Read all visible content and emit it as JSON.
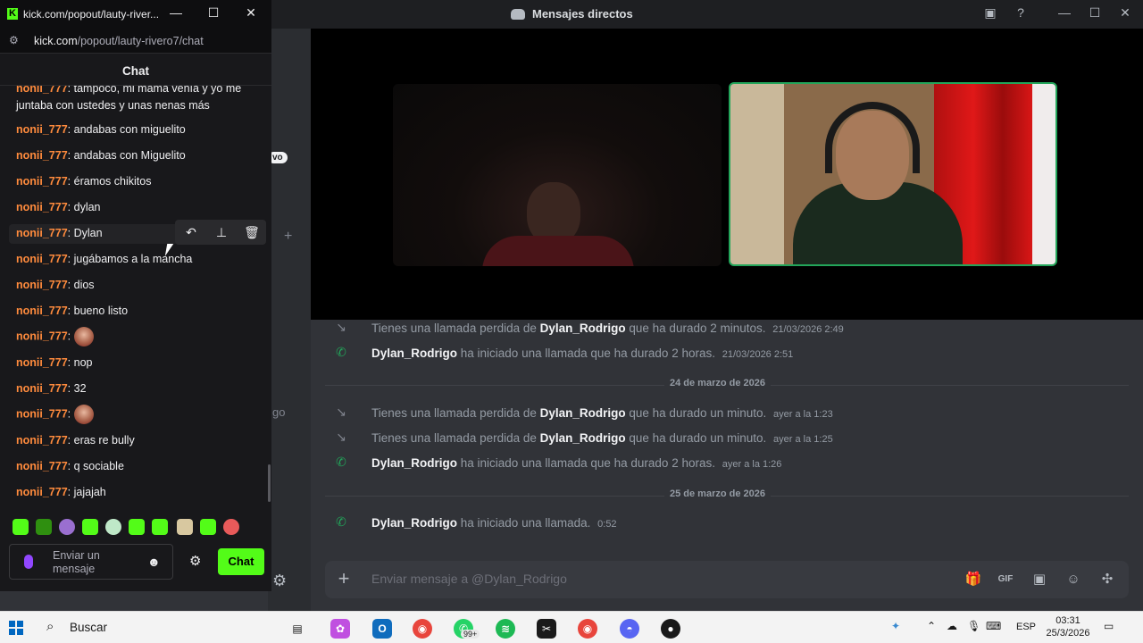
{
  "discord": {
    "window_title": "Mensajes directos",
    "messages": [
      {
        "type": "missed",
        "prefix": "Tienes una llamada perdida de ",
        "user": "Dylan_Rodrigo",
        "suffix": " que ha durado 2 minutos.",
        "time": "21/03/2026 2:49"
      },
      {
        "type": "call",
        "prefix": "",
        "user": "Dylan_Rodrigo",
        "suffix": " ha iniciado una llamada que ha durado 2 horas.",
        "time": "21/03/2026 2:51"
      },
      {
        "type": "missed",
        "prefix": "Tienes una llamada perdida de ",
        "user": "Dylan_Rodrigo",
        "suffix": " que ha durado un minuto.",
        "time": "ayer a la 1:23"
      },
      {
        "type": "missed",
        "prefix": "Tienes una llamada perdida de ",
        "user": "Dylan_Rodrigo",
        "suffix": " que ha durado un minuto.",
        "time": "ayer a la 1:25"
      },
      {
        "type": "call",
        "prefix": "",
        "user": "Dylan_Rodrigo",
        "suffix": " ha iniciado una llamada que ha durado 2 horas.",
        "time": "ayer a la 1:26"
      },
      {
        "type": "call",
        "prefix": "",
        "user": "Dylan_Rodrigo",
        "suffix": " ha iniciado una llamada.",
        "time": "0:52"
      }
    ],
    "dividers": [
      "24 de marzo de 2026",
      "25 de marzo de 2026"
    ],
    "composer_placeholder": "Enviar mensaje a @Dylan_Rodrigo",
    "bg_text": "go",
    "bg_badge": "vo"
  },
  "kick": {
    "window_title": "kick.com/popout/lauty-river...",
    "url_host": "kick.com",
    "url_path": "/popout/lauty-rivero7/chat",
    "header": "Chat",
    "nick": "nonii_777",
    "messages": [
      {
        "text": "tampoco, mi mamá venía y yo me juntaba con ustedes y unas nenas más"
      },
      {
        "text": "andabas con miguelito"
      },
      {
        "text": "andabas con Miguelito"
      },
      {
        "text": "éramos chikitos"
      },
      {
        "text": "dylan"
      },
      {
        "text": "Dylan"
      },
      {
        "text": "jugábamos a la mancha"
      },
      {
        "text": "dios"
      },
      {
        "text": "bueno listo"
      },
      {
        "text": "",
        "emote": true
      },
      {
        "text": "nop"
      },
      {
        "text": "32"
      },
      {
        "text": "",
        "emote": true
      },
      {
        "text": "eras re bully"
      },
      {
        "text": "q sociable"
      },
      {
        "text": "jajajah"
      }
    ],
    "input_placeholder": "Enviar un mensaje",
    "send_label": "Chat"
  },
  "taskbar": {
    "search_label": "Buscar",
    "badge_whatsapp": "99+",
    "lang": "ESP",
    "time": "03:31",
    "date": "25/3/2026"
  }
}
